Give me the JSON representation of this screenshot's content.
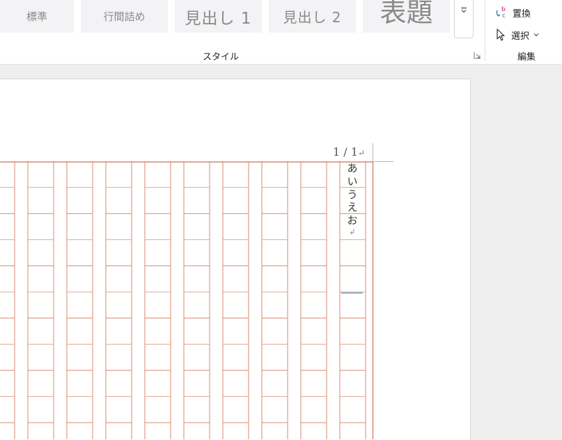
{
  "ribbon": {
    "styles": {
      "standard": "標準",
      "tight": "行間詰め",
      "heading1": "見出し 1",
      "heading2": "見出し 2",
      "title": "表題"
    },
    "style_group_label": "スタイル",
    "edit": {
      "replace_label": "置換",
      "select_label": "選択",
      "group_label": "編集"
    }
  },
  "document": {
    "page_number": "1 / 1",
    "paragraph_mark": "↵",
    "text_chars": [
      "あ",
      "い",
      "う",
      "え",
      "お"
    ],
    "return_mark": "↲"
  },
  "colors": {
    "grid_line": "#d9896e",
    "grid_line_light": "#e4a48f",
    "accent_blue": "#2e75b6",
    "accent_pink": "#c2185b"
  }
}
